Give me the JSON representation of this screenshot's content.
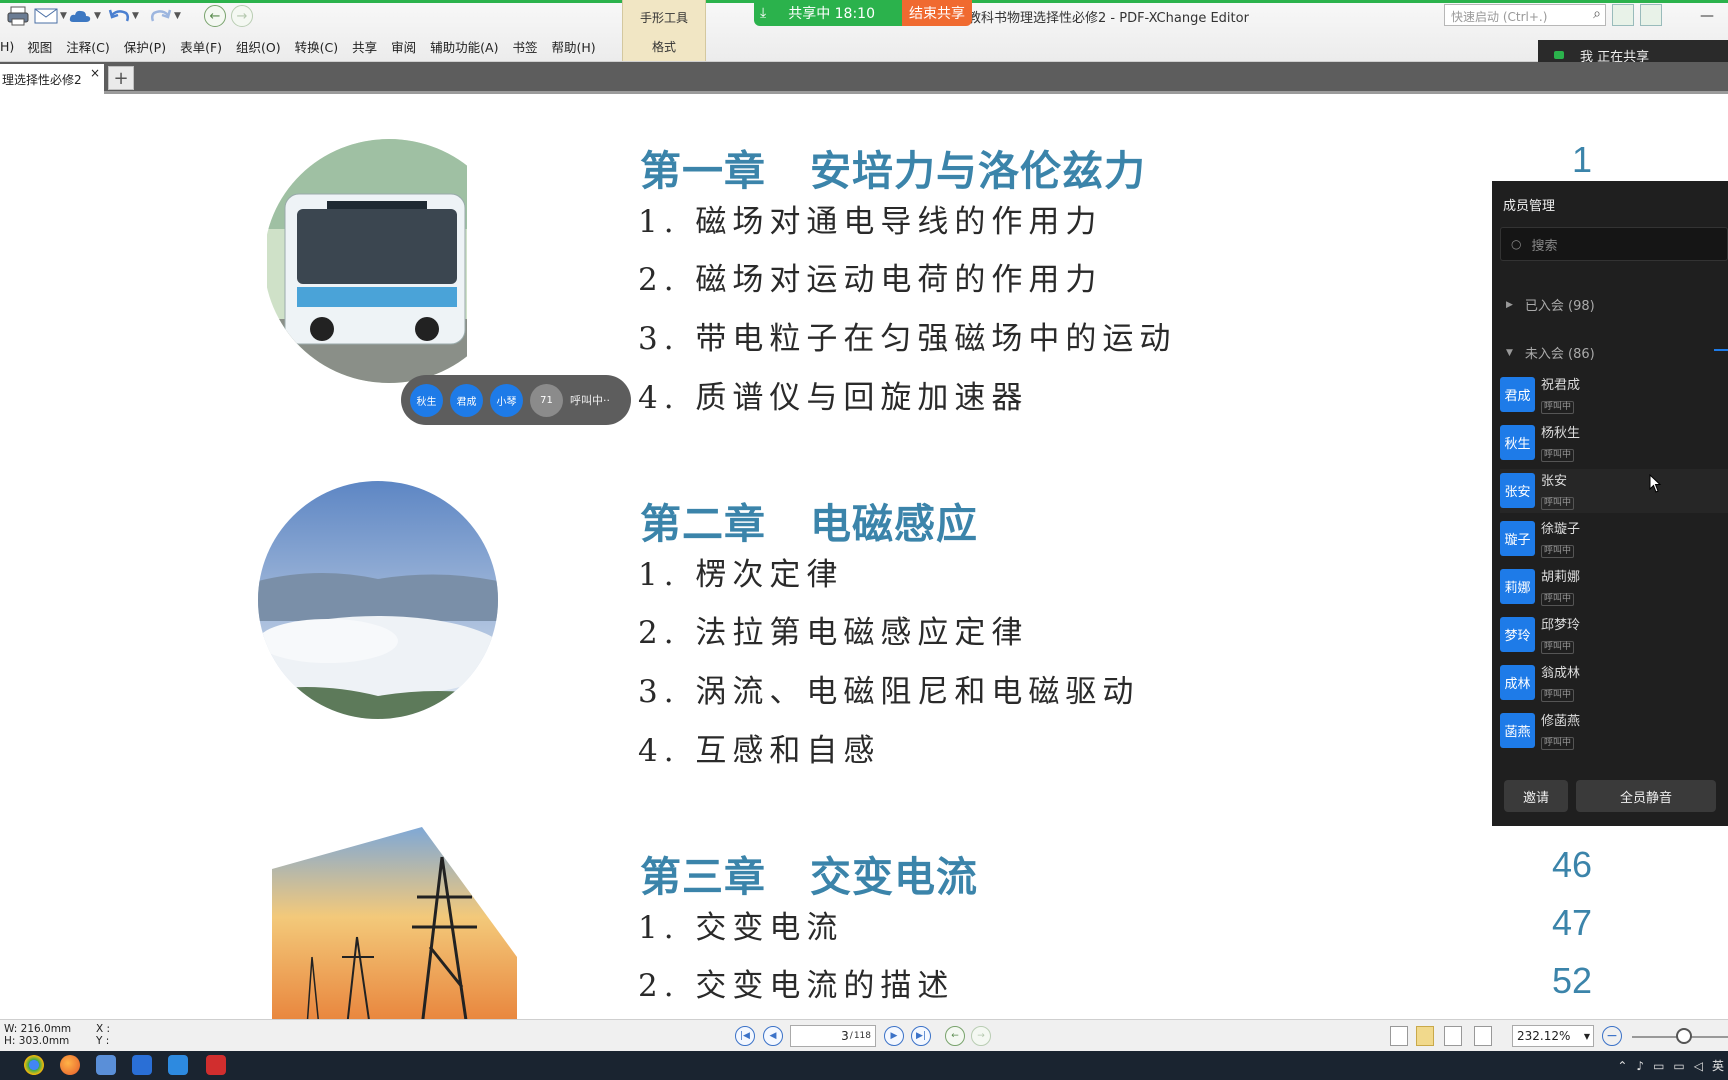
{
  "app": {
    "title": "教科书物理选择性必修2 - PDF-XChange Editor",
    "shape_tools": {
      "label": "手形工具",
      "format": "格式"
    },
    "quick_launch_placeholder": "快速启动 (Ctrl+.)"
  },
  "menu": [
    "H)",
    "视图",
    "注释(C)",
    "保护(P)",
    "表单(F)",
    "组织(O)",
    "转换(C)",
    "共享",
    "审阅",
    "辅助功能(A)",
    "书签",
    "帮助(H)"
  ],
  "share": {
    "status": "共享中 18:10",
    "end_label": "结束共享",
    "sharing_label": "我 正在共享"
  },
  "tabs": [
    {
      "label": "理选择性必修2",
      "close": "×"
    }
  ],
  "new_tab_label": "+",
  "document": {
    "chapters": [
      {
        "title_num": "第一章",
        "title_name": "安培力与洛伦兹力",
        "page": "1",
        "sections": [
          "1. 磁场对通电导线的作用力",
          "2. 磁场对运动电荷的作用力",
          "3. 带电粒子在匀强磁场中的运动",
          "4. 质谱仪与回旋加速器"
        ]
      },
      {
        "title_num": "第二章",
        "title_name": "电磁感应",
        "page": "",
        "sections": [
          "1. 楞次定律",
          "2. 法拉第电磁感应定律",
          "3. 涡流、电磁阻尼和电磁驱动",
          "4. 互感和自感"
        ]
      },
      {
        "title_num": "第三章",
        "title_name": "交变电流",
        "page": "46",
        "sections": [
          "1. 交变电流",
          "2. 交变电流的描述"
        ],
        "section_pages": [
          "47",
          "52"
        ]
      }
    ]
  },
  "call_pill": {
    "avatars": [
      "秋生",
      "君成",
      "小琴"
    ],
    "count": "71",
    "calling": "呼叫中··"
  },
  "members_panel": {
    "title": "成员管理",
    "search_placeholder": "搜索",
    "joined_group": "已入会 (98)",
    "not_joined_group": "未入会 (86)",
    "members": [
      {
        "avatar": "君成",
        "name": "祝君成",
        "status": "呼叫中"
      },
      {
        "avatar": "秋生",
        "name": "杨秋生",
        "status": "呼叫中"
      },
      {
        "avatar": "张安",
        "name": "张安",
        "status": "呼叫中"
      },
      {
        "avatar": "璇子",
        "name": "徐璇子",
        "status": "呼叫中"
      },
      {
        "avatar": "莉娜",
        "name": "胡莉娜",
        "status": "呼叫中"
      },
      {
        "avatar": "梦玲",
        "name": "邱梦玲",
        "status": "呼叫中"
      },
      {
        "avatar": "成林",
        "name": "翁成林",
        "status": "呼叫中"
      },
      {
        "avatar": "菡燕",
        "name": "修菡燕",
        "status": "呼叫中"
      }
    ],
    "invite_label": "邀请",
    "mute_all_label": "全员静音"
  },
  "statusbar": {
    "width": "W: 216.0mm",
    "height": "H: 303.0mm",
    "x_label": "X :",
    "y_label": "Y :",
    "current_page": "3",
    "total_pages": "118",
    "zoom": "232.12%"
  },
  "taskbar": {
    "ime": "英"
  },
  "colors": {
    "accent": "#3b84aa",
    "share_green": "#2bb24c",
    "end_share_orange": "#f06a30",
    "avatar_blue": "#1e7be8",
    "panel_bg": "#1f1f1f"
  }
}
